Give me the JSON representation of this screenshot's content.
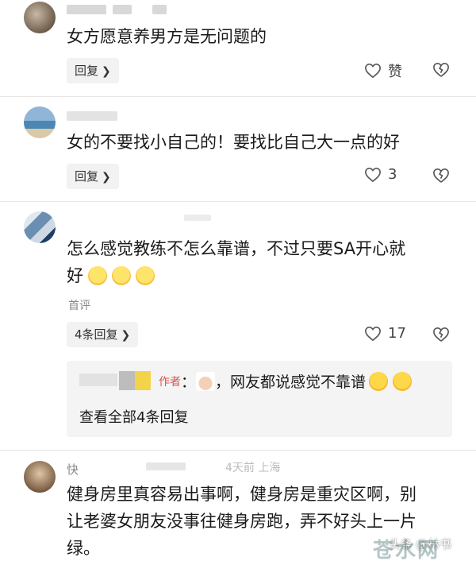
{
  "comments": [
    {
      "text": "女方愿意养男方是无问题的",
      "reply_label": "回复",
      "like_label": "赞"
    },
    {
      "text": "女的不要找小自己的！要找比自己大一点的好",
      "reply_label": "回复",
      "like_count": "3"
    },
    {
      "text_line1": "怎么感觉教练不怎么靠谱，不过只要SA开心就",
      "text_line2": "好",
      "tag": "首评",
      "reply_label": "4条回复",
      "like_count": "17",
      "sub_reply": {
        "author_tag": "作者",
        "separator": "：",
        "text": "，网友都说感觉不靠谱",
        "view_all": "查看全部4条回复"
      }
    },
    {
      "user_prefix": "快",
      "meta_fragment": "4天前 上海",
      "text_line1": "健身房里真容易出事啊，健身房是重灾区啊，别",
      "text_line2": "让老婆女朋友没事往健身房跑，弄不好头上一片",
      "text_line3": "绿。"
    }
  ],
  "watermark": {
    "brand": "头条",
    "handle": "@林书",
    "site": "苍水网"
  },
  "colors": {
    "pill_bg": "#f2f2f2",
    "sub_box_bg": "#f4f4f4",
    "divider": "#e6e6e6"
  }
}
